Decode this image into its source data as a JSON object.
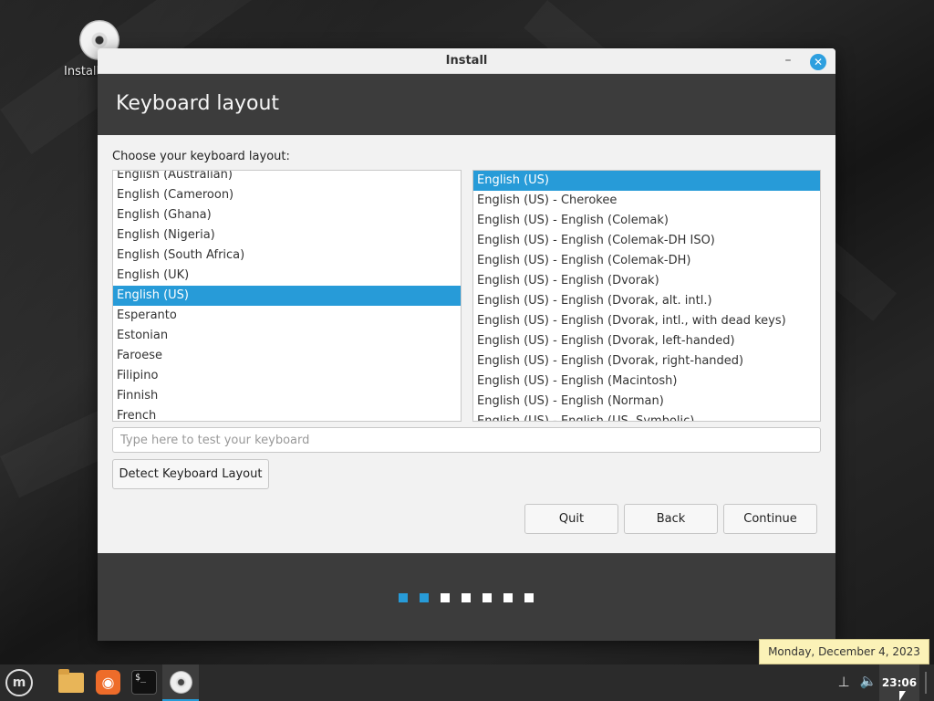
{
  "desktop": {
    "icon_label": "Install"
  },
  "window": {
    "title": "Install",
    "minimize_glyph": "–",
    "close_glyph": "✕",
    "heading": "Keyboard layout",
    "prompt": "Choose your keyboard layout:",
    "layouts": [
      "English (Australian)",
      "English (Cameroon)",
      "English (Ghana)",
      "English (Nigeria)",
      "English (South Africa)",
      "English (UK)",
      "English (US)",
      "Esperanto",
      "Estonian",
      "Faroese",
      "Filipino",
      "Finnish",
      "French"
    ],
    "selected_layout": "English (US)",
    "variants": [
      "English (US)",
      "English (US) - Cherokee",
      "English (US) - English (Colemak)",
      "English (US) - English (Colemak-DH ISO)",
      "English (US) - English (Colemak-DH)",
      "English (US) - English (Dvorak)",
      "English (US) - English (Dvorak, alt. intl.)",
      "English (US) - English (Dvorak, intl., with dead keys)",
      "English (US) - English (Dvorak, left-handed)",
      "English (US) - English (Dvorak, right-handed)",
      "English (US) - English (Macintosh)",
      "English (US) - English (Norman)",
      "English (US) - English (US, Symbolic)"
    ],
    "selected_variant": "English (US)",
    "test_placeholder": "Type here to test your keyboard",
    "test_value": "",
    "detect_label": "Detect Keyboard Layout",
    "quit_label": "Quit",
    "back_label": "Back",
    "continue_label": "Continue",
    "progress": {
      "total_steps": 7,
      "completed_steps": 2,
      "active_color": "#279bd8"
    }
  },
  "taskbar": {
    "items": [
      {
        "name": "menu",
        "icon": "mint-logo-icon"
      },
      {
        "name": "files",
        "icon": "folder-icon"
      },
      {
        "name": "firefox",
        "icon": "firefox-icon"
      },
      {
        "name": "terminal",
        "icon": "terminal-icon",
        "glyph": "$_"
      },
      {
        "name": "install",
        "icon": "install-disc-icon"
      }
    ],
    "clock": "23:06",
    "tooltip": "Monday, December 4, 2023"
  }
}
